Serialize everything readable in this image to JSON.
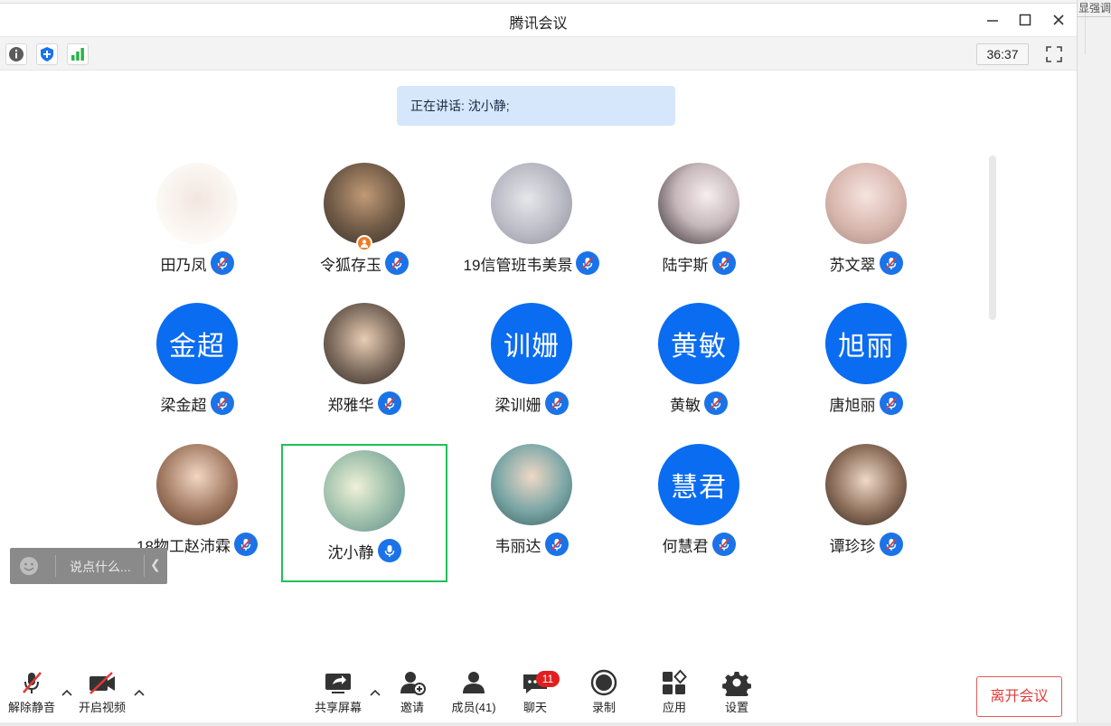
{
  "window": {
    "title": "腾讯会议"
  },
  "desktop": {
    "right_text": "显强调"
  },
  "toolbar": {
    "timer": "36:37"
  },
  "speaking": {
    "text": "正在讲话: 沈小静;"
  },
  "participants": [
    {
      "name": "田乃凤",
      "avatar_text": "",
      "avatar_icon": "cartoon-photo-avatar",
      "active": false
    },
    {
      "name": "令狐存玉",
      "avatar_text": "",
      "avatar_icon": "man-photo-avatar",
      "host": true,
      "active": false
    },
    {
      "name": "19信管班韦美景",
      "avatar_text": "",
      "avatar_icon": "sketch-photo-avatar",
      "active": false
    },
    {
      "name": "陆宇斯",
      "avatar_text": "",
      "avatar_icon": "anime-photo-avatar",
      "active": false
    },
    {
      "name": "苏文翠",
      "avatar_text": "",
      "avatar_icon": "girl-photo-avatar",
      "active": false
    },
    {
      "name": "梁金超",
      "avatar_text": "金超",
      "active": false
    },
    {
      "name": "郑雅华",
      "avatar_text": "",
      "avatar_icon": "child-photo-avatar",
      "active": false
    },
    {
      "name": "梁训姗",
      "avatar_text": "训姗",
      "active": false
    },
    {
      "name": "黄敏",
      "avatar_text": "黄敏",
      "active": false
    },
    {
      "name": "唐旭丽",
      "avatar_text": "旭丽",
      "active": false
    },
    {
      "name": "18物工赵沛霖",
      "avatar_text": "",
      "avatar_icon": "anime-boy-photo-avatar",
      "active": false
    },
    {
      "name": "沈小静",
      "avatar_text": "",
      "avatar_icon": "flower-photo-avatar",
      "active": true
    },
    {
      "name": "韦丽达",
      "avatar_text": "",
      "avatar_icon": "smiling-girl-photo-avatar",
      "active": false
    },
    {
      "name": "何慧君",
      "avatar_text": "慧君",
      "active": false
    },
    {
      "name": "谭珍珍",
      "avatar_text": "",
      "avatar_icon": "young-man-photo-avatar",
      "active": false
    }
  ],
  "chat_input": {
    "placeholder": "说点什么..."
  },
  "bottom": {
    "unmute": "解除静音",
    "video": "开启视频",
    "share": "共享屏幕",
    "invite": "邀请",
    "members": "成员(41)",
    "chat": "聊天",
    "chat_count": "11",
    "record": "录制",
    "apps": "应用",
    "settings": "设置",
    "leave": "离开会议"
  },
  "colors": {
    "accent": "#1a73e8",
    "active_border": "#22c05a",
    "danger": "#e03a3a",
    "avatar_bg": "#0a6cf0"
  }
}
